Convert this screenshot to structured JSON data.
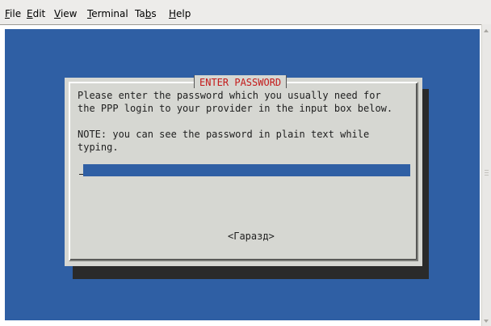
{
  "menubar": {
    "items": [
      {
        "label": "File",
        "mnemonic_index": 0
      },
      {
        "label": "Edit",
        "mnemonic_index": 0
      },
      {
        "label": "View",
        "mnemonic_index": 0
      },
      {
        "label": "Terminal",
        "mnemonic_index": 0
      },
      {
        "label": "Tabs",
        "mnemonic_index": 2
      },
      {
        "label": "Help",
        "mnemonic_index": 0
      }
    ]
  },
  "dialog": {
    "title": "ENTER PASSWORD",
    "line1": "Please enter the password which you usually need for",
    "line2": "the PPP login to your provider in the input box below.",
    "line3": "NOTE: you can see the password in plain text while",
    "line4": "typing.",
    "input_value": "",
    "ok_label": "<Гаразд>"
  },
  "colors": {
    "terminal_bg": "#2f5fa4",
    "dialog_bg": "#d6d7d2",
    "title_color": "#c41a1a"
  }
}
